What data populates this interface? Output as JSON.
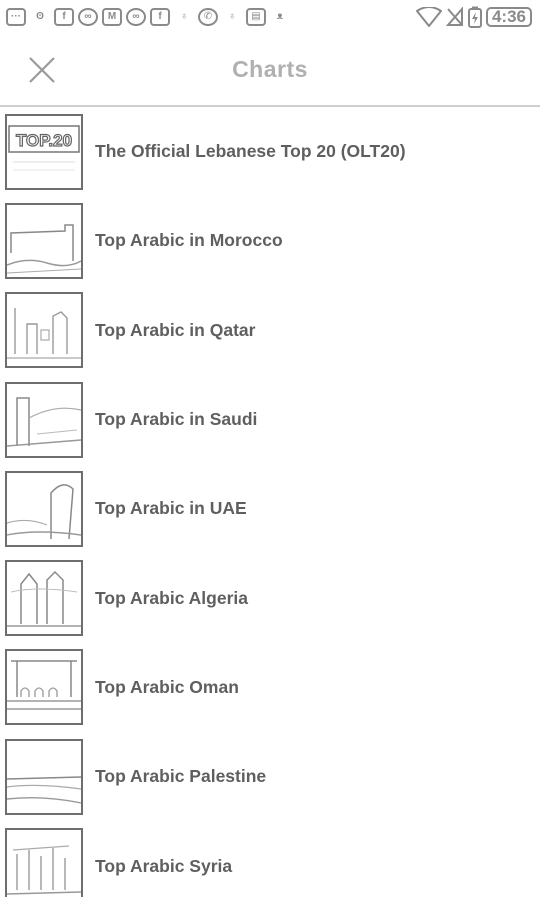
{
  "status_bar": {
    "time": "4:36",
    "icons": [
      "messages-icon",
      "snapchat-icon",
      "facebook-icon",
      "sound-icon",
      "gmail-icon",
      "sound-icon",
      "facebook-icon",
      "bag-icon",
      "whatsapp-icon",
      "bag-icon",
      "sim-icon",
      "cat-icon",
      "wifi-icon",
      "no-signal-icon",
      "battery-icon"
    ]
  },
  "header": {
    "title": "Charts",
    "close_icon": "close-icon"
  },
  "thumb_badge": "TOP.20",
  "charts": [
    {
      "label": "The Official Lebanese Top 20 (OLT20)",
      "thumb": "top20"
    },
    {
      "label": "Top Arabic in Morocco",
      "thumb": "fort"
    },
    {
      "label": "Top Arabic in Qatar",
      "thumb": "city"
    },
    {
      "label": "Top Arabic in Saudi",
      "thumb": "tower"
    },
    {
      "label": "Top Arabic in UAE",
      "thumb": "sail"
    },
    {
      "label": "Top Arabic Algeria",
      "thumb": "monument"
    },
    {
      "label": "Top Arabic Oman",
      "thumb": "palace"
    },
    {
      "label": "Top Arabic Palestine",
      "thumb": "coast"
    },
    {
      "label": "Top Arabic Syria",
      "thumb": "ruins"
    }
  ]
}
